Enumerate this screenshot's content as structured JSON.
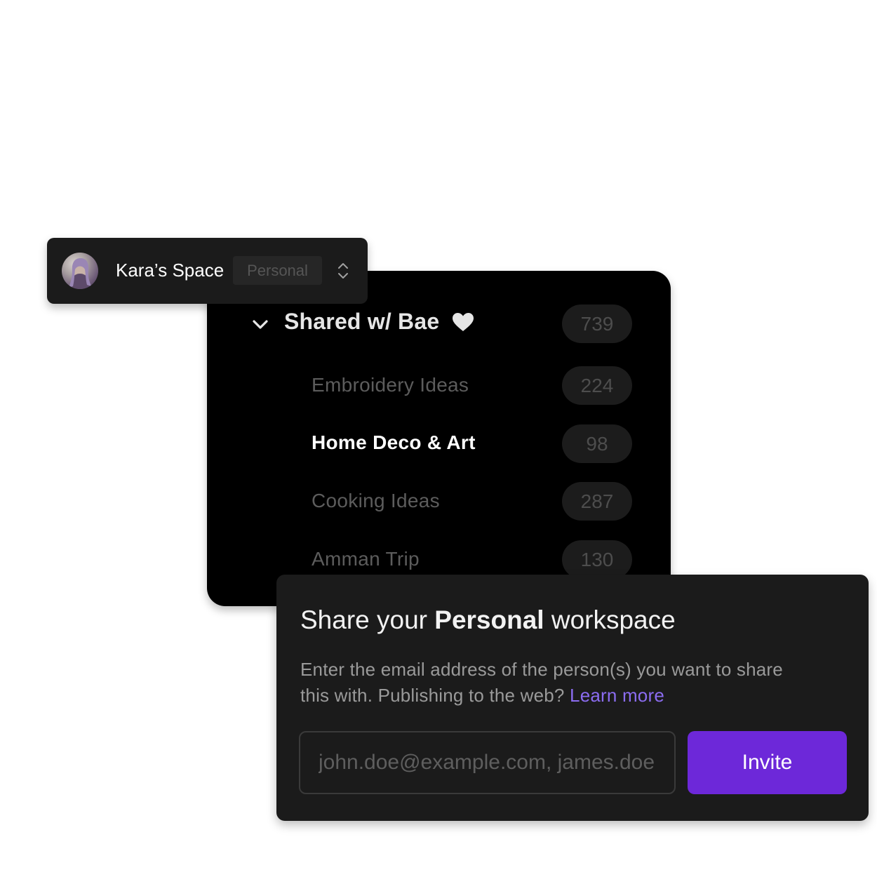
{
  "switcher": {
    "space_name": "Kara’s Space",
    "badge": "Personal",
    "avatar_icon": "avatar-photo",
    "toggle_icon": "chevron-up-down-icon"
  },
  "collections": {
    "group": {
      "title": "Shared w/ Bae",
      "count": "739",
      "icon": "heart-icon",
      "expand_icon": "chevron-down-icon"
    },
    "items": [
      {
        "label": "Embroidery Ideas",
        "count": "224",
        "active": false
      },
      {
        "label": "Home Deco & Art",
        "count": "98",
        "active": true
      },
      {
        "label": "Cooking Ideas",
        "count": "287",
        "active": false
      },
      {
        "label": "Amman Trip",
        "count": "130",
        "active": false
      }
    ]
  },
  "share": {
    "title_prefix": "Share your",
    "title_bold": "Personal",
    "title_suffix": "workspace",
    "description": "Enter the email address of the person(s) you want to share this with. Publishing to the web?",
    "learn_more": "Learn more",
    "email_placeholder": "john.doe@example.com, james.doe@example.com",
    "invite_label": "Invite"
  },
  "colors": {
    "accent": "#6d28d9",
    "link": "#8b6cf0",
    "panel_bg": "#000000",
    "card_bg": "#1b1b1b"
  }
}
